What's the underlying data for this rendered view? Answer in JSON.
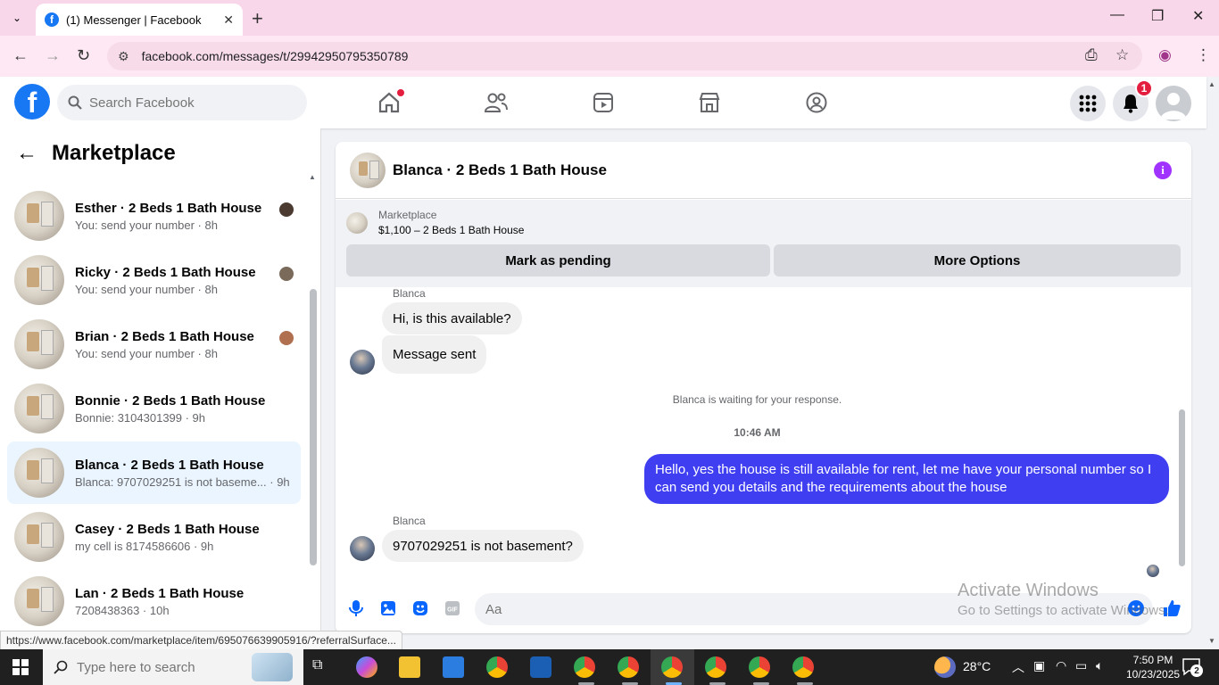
{
  "browser": {
    "tab_title": "(1) Messenger | Facebook",
    "url": "facebook.com/messages/t/29942950795350789",
    "status_url": "https://www.facebook.com/marketplace/item/695076639905916/?referralSurface..."
  },
  "fb_header": {
    "search_placeholder": "Search Facebook",
    "notification_count": "1"
  },
  "sidebar": {
    "title": "Marketplace",
    "conversations": [
      {
        "name": "Esther · 2 Beds 1 Bath House",
        "preview": "You: send your number · 8h",
        "active": false
      },
      {
        "name": "Ricky · 2 Beds 1 Bath House",
        "preview": "You: send your number · 8h",
        "active": false
      },
      {
        "name": "Brian · 2 Beds 1 Bath House",
        "preview": "You: send your number · 8h",
        "active": false
      },
      {
        "name": "Bonnie · 2 Beds 1 Bath House",
        "preview": "Bonnie: 3104301399 · 9h",
        "active": false
      },
      {
        "name": "Blanca · 2 Beds 1 Bath House",
        "preview": "Blanca: 9707029251 is not baseme... · 9h",
        "active": true
      },
      {
        "name": "Casey · 2 Beds 1 Bath House",
        "preview": "my cell is 8174586606 · 9h",
        "active": false
      },
      {
        "name": "Lan · 2 Beds 1 Bath House",
        "preview": "7208438363 · 10h",
        "active": false
      }
    ]
  },
  "chat": {
    "title": "Blanca · 2 Beds 1 Bath House",
    "marketplace_label": "Marketplace",
    "listing": "$1,100 – 2 Beds 1 Bath House",
    "mark_pending": "Mark as pending",
    "more_options": "More Options",
    "sender_name": "Blanca",
    "msg1": "Hi, is this available?",
    "msg2": "Message sent",
    "waiting_note": "Blanca is waiting for your response.",
    "time": "10:46 AM",
    "outgoing": "Hello, yes the house is still available for rent, let me have your personal number so I can send you details and the requirements about the house",
    "msg3": "9707029251 is not basement?",
    "compose_placeholder": "Aa"
  },
  "watermark": {
    "line1": "Activate Windows",
    "line2": "Go to Settings to activate Windows."
  },
  "taskbar": {
    "search_placeholder": "Type here to search",
    "weather": "28°C",
    "time": "7:50 PM",
    "date": "10/23/2025",
    "notif_count": "2"
  },
  "colors": {
    "fb_blue": "#1877f2",
    "outgoing_bubble": "#3f3ef0",
    "active_row": "#ebf5ff",
    "badge_red": "#e41e3f"
  }
}
